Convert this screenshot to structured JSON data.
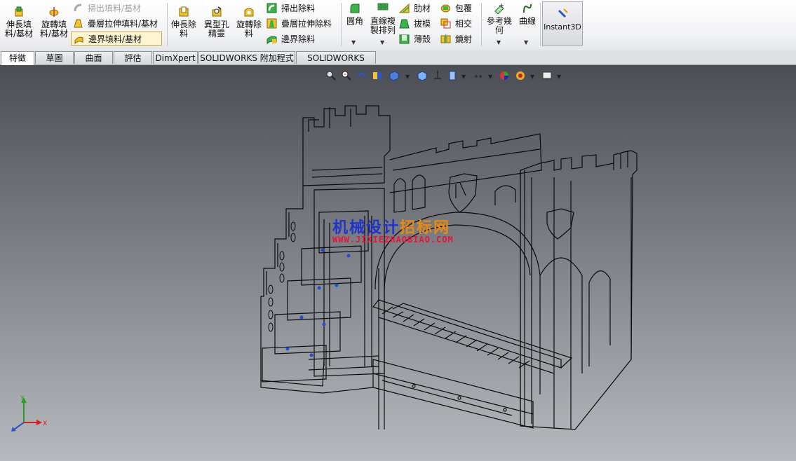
{
  "ribbon": {
    "extrude_boss": "伸長填\n料/基材",
    "revolve_boss": "旋轉填\n料/基材",
    "swept_boss": "掃出填料/基材",
    "lofted_boss": "疊層拉伸填料/基材",
    "boundary_boss": "邊界填料/基材",
    "extrude_cut": "伸長除\n料",
    "hole_wizard": "異型孔\n精靈",
    "revolve_cut": "旋轉除\n料",
    "swept_cut": "掃出除料",
    "lofted_cut": "疊層拉伸除料",
    "boundary_cut": "邊界除料",
    "fillet": "圓角",
    "linear_pattern": "直線複\n製排列",
    "rib": "肋材",
    "draft": "拔模",
    "shell": "薄殼",
    "wrap": "包覆",
    "intersect": "相交",
    "mirror": "鏡射",
    "reference_geometry": "參考幾\n何",
    "curves": "曲線",
    "instant3d": "Instant3D"
  },
  "tabs": [
    "特徵",
    "草圖",
    "曲面",
    "評估",
    "DimXpert",
    "SOLIDWORKS 附加程式",
    "SOLIDWORKS MBD"
  ],
  "active_tab": "特徵",
  "watermark": {
    "line1_a": "机械设计",
    "line1_b": "招标网",
    "line2": "WWW.JIXIEZHAOBIAO.COM"
  },
  "triad": {
    "x": "X",
    "y": "Y"
  },
  "colors": {
    "watermark_blue": "#2233c8",
    "watermark_orange": "#e88a12",
    "watermark_red": "#e6153a"
  }
}
